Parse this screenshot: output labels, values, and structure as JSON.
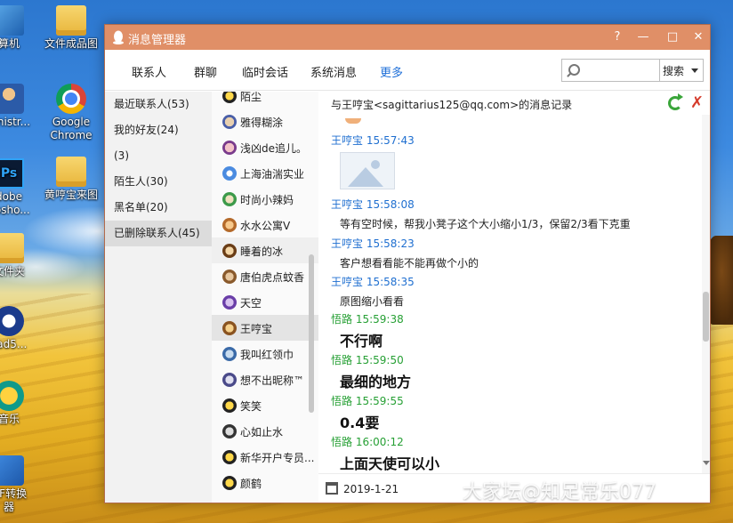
{
  "desktop": {
    "icons": [
      {
        "label_line1": "算机",
        "label_line2": "",
        "icon": "computer-icon"
      },
      {
        "label_line1": "文件成品图",
        "label_line2": "",
        "icon": "folder-icon"
      },
      {
        "label_line1": "ninistr...",
        "label_line2": "",
        "icon": "user-icon"
      },
      {
        "label_line1": "Google",
        "label_line2": "Chrome",
        "icon": "chrome-icon"
      },
      {
        "label_line1": "dobe",
        "label_line2": "nosho...",
        "icon": "photoshop-icon"
      },
      {
        "label_line1": "黄哼宝来图",
        "label_line2": "",
        "icon": "folder-icon"
      },
      {
        "label_line1": "文件夹",
        "label_line2": "",
        "icon": "folder-icon"
      },
      {
        "label_line1": "cad5...",
        "label_line2": "",
        "icon": "cad-icon"
      },
      {
        "label_line1": "音乐",
        "label_line2": "",
        "icon": "music-icon"
      },
      {
        "label_line1": "DF转换",
        "label_line2": "器",
        "icon": "pdf-icon"
      }
    ]
  },
  "window": {
    "title": "消息管理器",
    "controls": {
      "help": "?",
      "minimize": "—",
      "maximize": "□",
      "close": "✕"
    }
  },
  "tabs": {
    "items": [
      {
        "label": "联系人",
        "active": false
      },
      {
        "label": "群聊",
        "active": false
      },
      {
        "label": "临时会话",
        "active": false
      },
      {
        "label": "系统消息",
        "active": false
      },
      {
        "label": "更多",
        "active": true
      }
    ]
  },
  "search": {
    "value": "",
    "placeholder": "",
    "mode": "搜索"
  },
  "categories": [
    {
      "label": "最近联系人(53)"
    },
    {
      "label": "我的好友(24)"
    },
    {
      "label": "(3)"
    },
    {
      "label": "陌生人(30)"
    },
    {
      "label": "黑名单(20)"
    },
    {
      "label": "已删除联系人(45)"
    }
  ],
  "contacts": [
    {
      "name": "陌尘"
    },
    {
      "name": "雅得糊涂"
    },
    {
      "name": "浅凶de追儿。"
    },
    {
      "name": "上海油湍实业"
    },
    {
      "name": "时尚小辣妈"
    },
    {
      "name": "水水公寓V"
    },
    {
      "name": "睡着的冰"
    },
    {
      "name": "唐伯虎点蚊香"
    },
    {
      "name": "天空"
    },
    {
      "name": "王哼宝"
    },
    {
      "name": "我叫红领巾"
    },
    {
      "name": "想不出昵称™"
    },
    {
      "name": "笑笑"
    },
    {
      "name": "心如止水"
    },
    {
      "name": "新华开户专员..."
    },
    {
      "name": "颜鹤"
    }
  ],
  "messages": {
    "header": "与王哼宝<sagittarius125@qq.com>的消息记录",
    "entries": [
      {
        "sender": "王哼宝",
        "time": "15:57:43",
        "text": "",
        "color": "blue",
        "big": false,
        "image": true
      },
      {
        "sender": "王哼宝",
        "time": "15:58:08",
        "text": "等有空时候，帮我小凳子这个大小缩小1/3，保留2/3看下克重",
        "color": "blue",
        "big": false
      },
      {
        "sender": "王哼宝",
        "time": "15:58:23",
        "text": "客户想看看能不能再做个小的",
        "color": "blue",
        "big": false
      },
      {
        "sender": "王哼宝",
        "time": "15:58:35",
        "text": "原图缩小看看",
        "color": "blue",
        "big": false
      },
      {
        "sender": "悟路",
        "time": "15:59:38",
        "text": "不行啊",
        "color": "green",
        "big": true
      },
      {
        "sender": "悟路",
        "time": "15:59:50",
        "text": "最细的地方",
        "color": "green",
        "big": true
      },
      {
        "sender": "悟路",
        "time": "15:59:55",
        "text": "0.4要",
        "color": "green",
        "big": true
      },
      {
        "sender": "悟路",
        "time": "16:00:12",
        "text": "上面天使可以小",
        "color": "green",
        "big": true
      }
    ]
  },
  "date_bar": {
    "date": "2019-1-21"
  },
  "watermark": "大家坛@知足常乐077",
  "colors": {
    "titlebar": "#e08f67",
    "active_tab": "#1e6fd8",
    "sender_blue": "#1f6fd0",
    "sender_green": "#27a035"
  }
}
